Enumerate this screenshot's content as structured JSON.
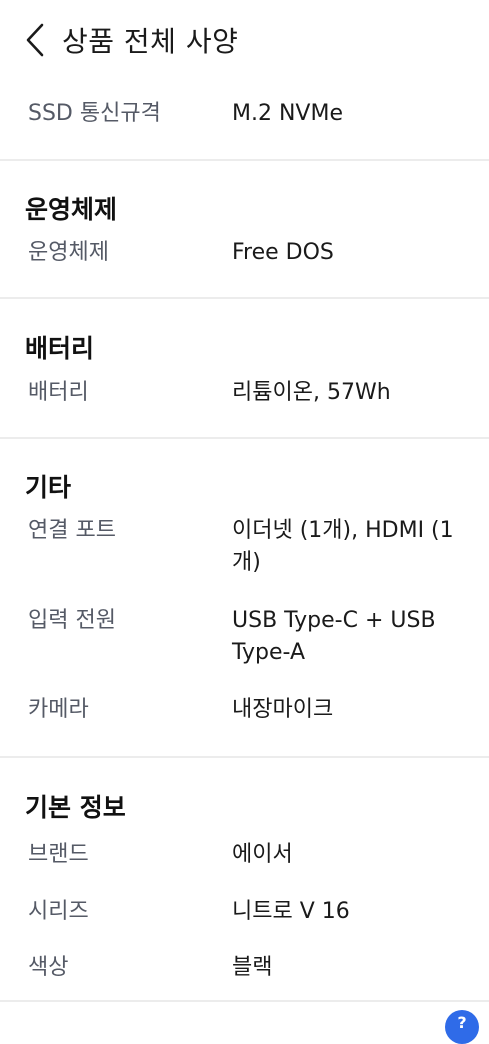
{
  "header": {
    "title": "상품 전체 사양",
    "back_icon": "chevron-left-icon"
  },
  "sections": [
    {
      "rows": [
        {
          "label": "SSD 통신규격",
          "value": "M.2 NVMe"
        }
      ]
    },
    {
      "title": "운영체제",
      "rows": [
        {
          "label": "운영체제",
          "value": "Free DOS"
        }
      ]
    },
    {
      "title": "배터리",
      "rows": [
        {
          "label": "배터리",
          "value": "리튬이온, 57Wh"
        }
      ]
    },
    {
      "title": "기타",
      "rows": [
        {
          "label": "연결 포트",
          "value": "이더넷 (1개), HDMI (1개)"
        },
        {
          "label": "입력 전원",
          "value": "USB Type-C + USB Type-A"
        },
        {
          "label": "카메라",
          "value": "내장마이크"
        }
      ]
    },
    {
      "title": "기본 정보",
      "rows": [
        {
          "label": "브랜드",
          "value": "에이서"
        },
        {
          "label": "시리즈",
          "value": "니트로 V 16"
        },
        {
          "label": "색상",
          "value": "블랙"
        }
      ]
    }
  ],
  "fab": {
    "icon": "help-icon",
    "label": "?"
  }
}
